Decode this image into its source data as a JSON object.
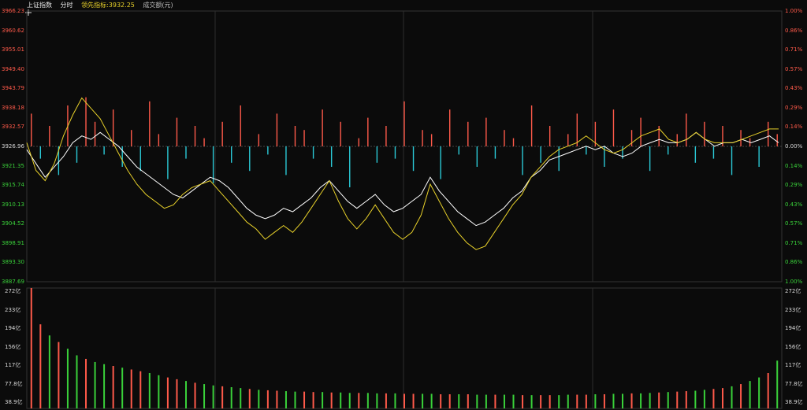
{
  "header": {
    "index_name": "上证指数",
    "timeframe": "分时",
    "leading_label": "领先指标:3932.25",
    "volume_label": "成交额(元)"
  },
  "price_axis_left": [
    "3966.23",
    "3960.62",
    "3955.01",
    "3949.40",
    "3943.79",
    "3938.18",
    "3932.57",
    "3926.96",
    "3921.35",
    "3915.74",
    "3910.13",
    "3904.52",
    "3898.91",
    "3893.30",
    "3887.69"
  ],
  "pct_axis_right": [
    "1.00%",
    "0.86%",
    "0.71%",
    "0.57%",
    "0.43%",
    "0.29%",
    "0.14%",
    "0.00%",
    "0.14%",
    "0.29%",
    "0.43%",
    "0.57%",
    "0.71%",
    "0.86%",
    "1.00%"
  ],
  "volume_axis": [
    "272亿",
    "233亿",
    "194亿",
    "156亿",
    "117亿",
    "77.8亿",
    "38.9亿"
  ],
  "colors": {
    "up": "#ff5a4a",
    "down": "#2bc9d6",
    "price_line": "#ffffff",
    "lead_line": "#e8d12a",
    "vol_up": "#ff5a4a",
    "vol_down": "#3ad13a",
    "grid": "#2a2a2a"
  },
  "chart_data": {
    "type": "line",
    "prev_close": 3926.96,
    "ylim": [
      3887.69,
      3966.23
    ],
    "volume_ylim": [
      0,
      272
    ],
    "series": [
      {
        "key": "price",
        "values": [
          3926,
          3922,
          3918,
          3921,
          3924,
          3928,
          3930,
          3929,
          3931,
          3929,
          3927,
          3924,
          3921,
          3919,
          3917,
          3915,
          3913,
          3912,
          3914,
          3916,
          3918,
          3917,
          3915,
          3912,
          3909,
          3907,
          3906,
          3907,
          3909,
          3908,
          3910,
          3912,
          3915,
          3917,
          3914,
          3911,
          3909,
          3911,
          3913,
          3910,
          3908,
          3909,
          3911,
          3913,
          3918,
          3914,
          3911,
          3908,
          3906,
          3904,
          3905,
          3907,
          3909,
          3912,
          3914,
          3918,
          3920,
          3923,
          3924,
          3925,
          3926,
          3927,
          3926,
          3927,
          3925,
          3924,
          3925,
          3927,
          3928,
          3929,
          3928,
          3928,
          3929,
          3931,
          3929,
          3927,
          3928,
          3928,
          3929,
          3928,
          3929,
          3930,
          3928
        ]
      },
      {
        "key": "lead",
        "values": [
          3928,
          3920,
          3917,
          3922,
          3930,
          3936,
          3941,
          3938,
          3935,
          3930,
          3925,
          3920,
          3916,
          3913,
          3911,
          3909,
          3910,
          3913,
          3915,
          3916,
          3917,
          3914,
          3911,
          3908,
          3905,
          3903,
          3900,
          3902,
          3904,
          3902,
          3905,
          3909,
          3913,
          3917,
          3911,
          3906,
          3903,
          3906,
          3910,
          3906,
          3902,
          3900,
          3902,
          3907,
          3916,
          3911,
          3906,
          3902,
          3899,
          3897,
          3898,
          3902,
          3906,
          3910,
          3913,
          3918,
          3921,
          3924,
          3926,
          3927,
          3928,
          3930,
          3928,
          3926,
          3925,
          3926,
          3928,
          3930,
          3931,
          3932,
          3929,
          3928,
          3929,
          3931,
          3929,
          3928,
          3928,
          3928,
          3929,
          3930,
          3931,
          3932,
          3932
        ]
      }
    ],
    "breadth": [
      8,
      -3,
      5,
      -7,
      10,
      -4,
      12,
      6,
      -2,
      9,
      -5,
      4,
      -6,
      11,
      3,
      -8,
      7,
      -3,
      5,
      2,
      -9,
      6,
      -4,
      10,
      -6,
      3,
      -2,
      8,
      -7,
      5,
      4,
      -3,
      9,
      -5,
      6,
      -10,
      2,
      7,
      -4,
      5,
      -3,
      11,
      -6,
      4,
      3,
      -8,
      9,
      -2,
      6,
      -5,
      7,
      -3,
      4,
      2,
      -7,
      10,
      -4,
      5,
      -6,
      3,
      8,
      -2,
      6,
      -5,
      9,
      -3,
      4,
      7,
      -6,
      5,
      -2,
      3,
      8,
      -4,
      6,
      -3,
      5,
      -7,
      4,
      2,
      -5,
      6,
      3
    ],
    "volume": [
      272,
      190,
      165,
      150,
      135,
      120,
      112,
      105,
      100,
      96,
      92,
      88,
      84,
      80,
      75,
      70,
      66,
      62,
      58,
      55,
      52,
      50,
      48,
      46,
      44,
      42,
      41,
      40,
      39,
      38,
      38,
      37,
      37,
      36,
      36,
      35,
      35,
      35,
      34,
      34,
      34,
      33,
      33,
      33,
      33,
      32,
      32,
      32,
      32,
      31,
      31,
      31,
      31,
      31,
      30,
      30,
      30,
      30,
      30,
      31,
      31,
      31,
      32,
      32,
      33,
      33,
      34,
      34,
      35,
      36,
      37,
      38,
      39,
      40,
      42,
      44,
      46,
      50,
      55,
      62,
      70,
      80,
      108
    ]
  }
}
